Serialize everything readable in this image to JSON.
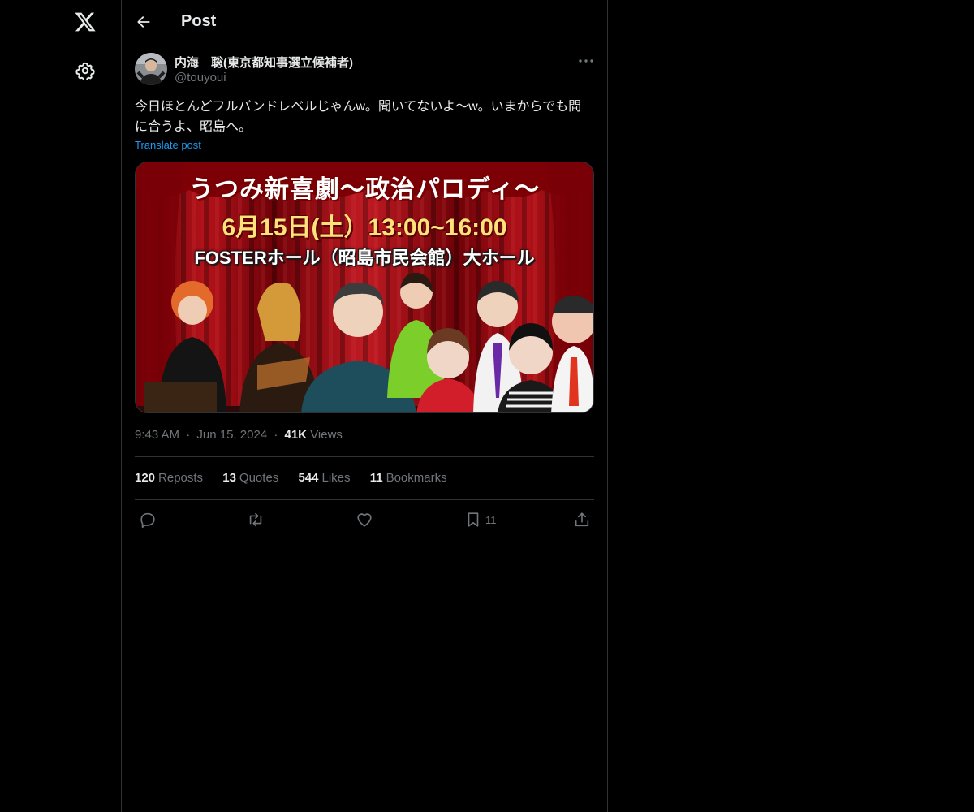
{
  "nav": {
    "logo_icon": "x-logo-icon",
    "settings_icon": "gear-icon"
  },
  "header": {
    "back_icon": "arrow-left-icon",
    "title": "Post"
  },
  "post": {
    "author": {
      "name": "内海　聡(東京都知事選立候補者)",
      "handle": "@touyoui"
    },
    "more_icon": "more-horizontal-icon",
    "text": "今日ほとんどフルバンドレベルじゃんw。聞いてないよ〜w。いまからでも間に合うよ、昭島へ。",
    "translate_label": "Translate post",
    "media": {
      "title": "うつみ新喜劇〜政治パロディ〜",
      "date": "6月15日(土）13:00~16:00",
      "venue": "FOSTERホール（昭島市民会館）大ホール"
    },
    "time": "9:43 AM",
    "date": "Jun 15, 2024",
    "views_count": "41K",
    "views_label": "Views",
    "separator": "·",
    "stats": {
      "reposts_count": "120",
      "reposts_label": "Reposts",
      "quotes_count": "13",
      "quotes_label": "Quotes",
      "likes_count": "544",
      "likes_label": "Likes",
      "bookmarks_count": "11",
      "bookmarks_label": "Bookmarks"
    },
    "actions": {
      "reply_icon": "reply-icon",
      "repost_icon": "repost-icon",
      "like_icon": "heart-icon",
      "bookmark_icon": "bookmark-icon",
      "bookmark_count": "11",
      "share_icon": "share-icon"
    }
  },
  "colors": {
    "background": "#000000",
    "text": "#e7e9ea",
    "secondary": "#71767b",
    "link": "#1d9bf0",
    "border": "#2f3336"
  }
}
